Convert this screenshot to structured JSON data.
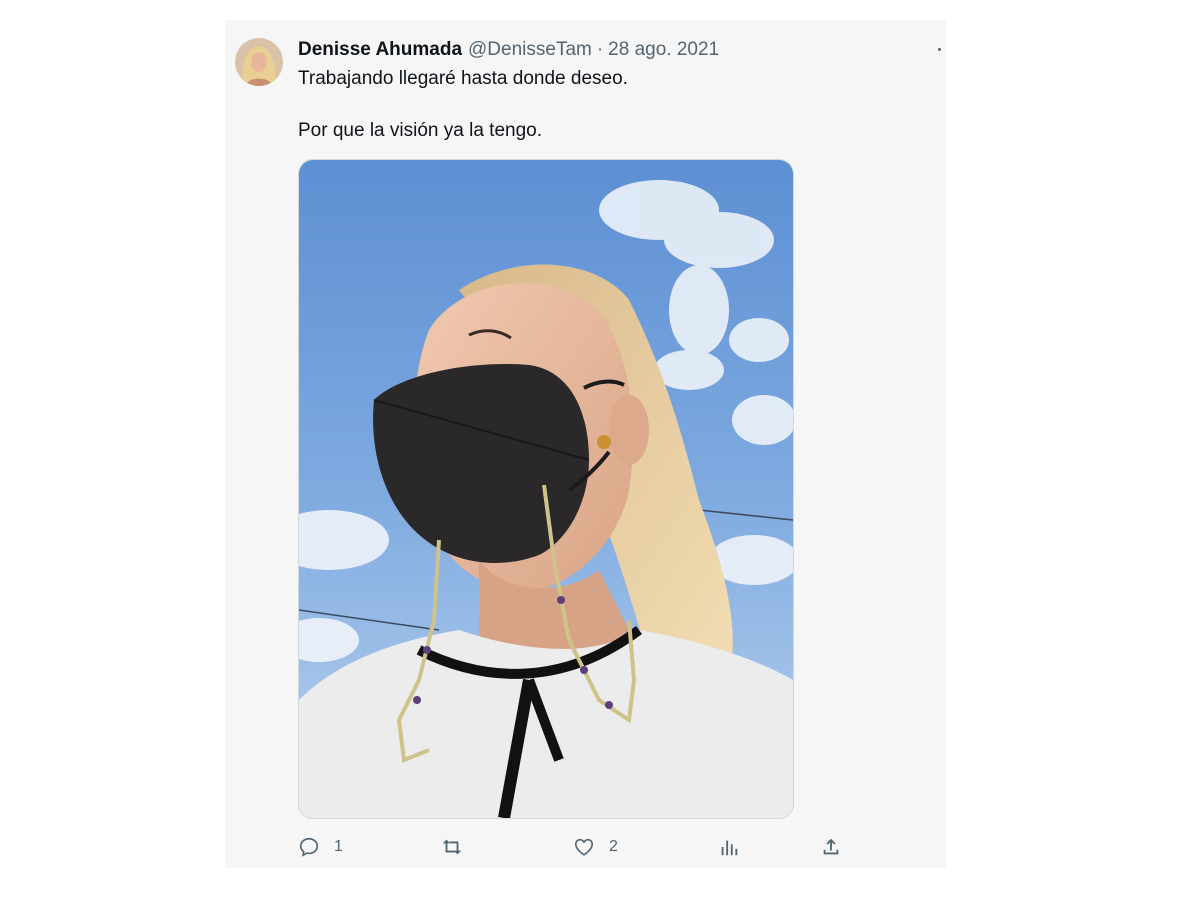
{
  "tweet": {
    "display_name": "Denisse Ahumada",
    "handle": "@DenisseTam",
    "separator": "·",
    "date": "28 ago. 2021",
    "text_line1": "Trabajando llegaré hasta donde deseo.",
    "text_line2": "Por que la visión ya la tengo.",
    "image_alt": "Selfie de una mujer con cubrebocas negro y cielo azul con nubes"
  },
  "actions": {
    "reply": {
      "icon": "reply-icon",
      "count": "1"
    },
    "retweet": {
      "icon": "retweet-icon",
      "count": ""
    },
    "like": {
      "icon": "heart-icon",
      "count": "2"
    },
    "views": {
      "icon": "analytics-icon"
    },
    "share": {
      "icon": "share-icon"
    }
  },
  "colors": {
    "text_primary": "#0f1419",
    "text_secondary": "#536471",
    "card_background": "#f6f6f7"
  }
}
